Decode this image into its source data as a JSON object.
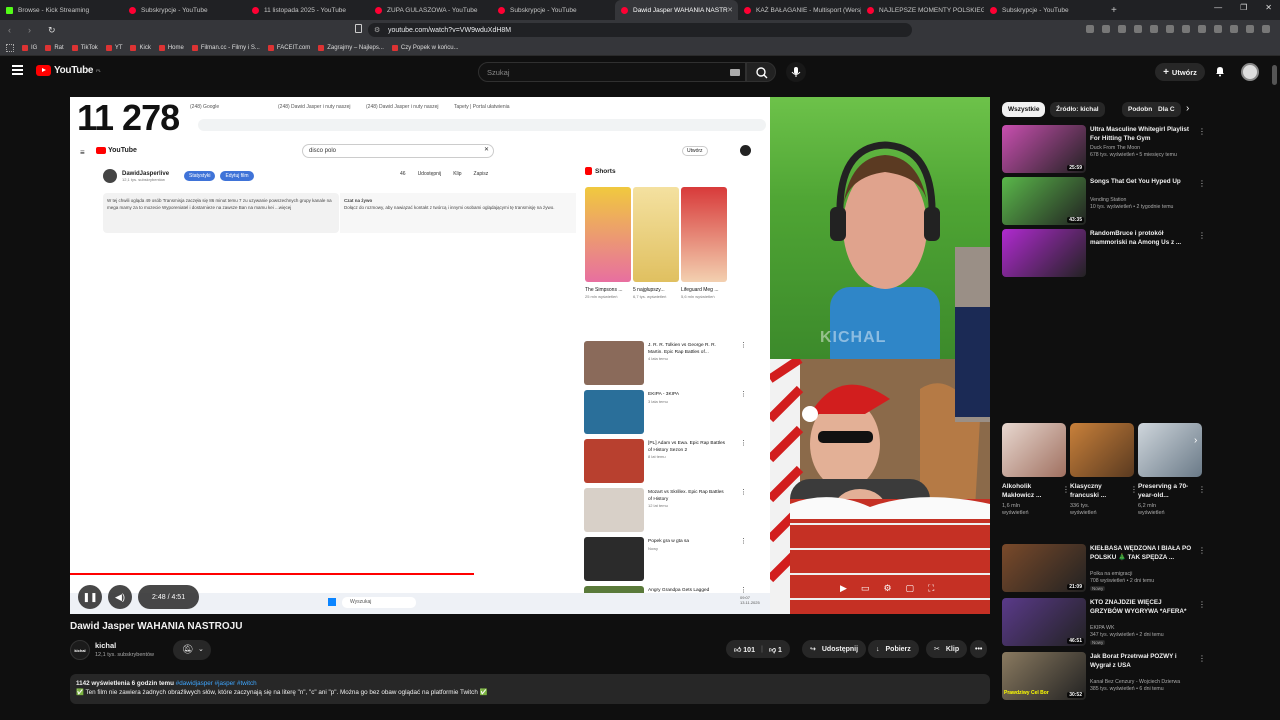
{
  "browser": {
    "tabs": [
      {
        "title": "Browse - Kick Streaming",
        "kind": "kick"
      },
      {
        "title": "Subskrypcje - YouTube",
        "kind": "yt"
      },
      {
        "title": "11 listopada 2025 - YouTube",
        "kind": "yt"
      },
      {
        "title": "ZUPA GULASZOWA - YouTube",
        "kind": "yt"
      },
      {
        "title": "Subskrypcje - YouTube",
        "kind": "yt"
      },
      {
        "title": "Dawid Jasper WAHANIA NASTR",
        "kind": "yt",
        "active": true
      },
      {
        "title": "KAŻ BAŁAGANIE - Multisport (Wersja",
        "kind": "yt"
      },
      {
        "title": "NAJLEPSZE MOMENTY POLSKIEGO",
        "kind": "yt"
      },
      {
        "title": "Subskrypcje - YouTube",
        "kind": "yt"
      }
    ],
    "url": "youtube.com/watch?v=VW9wduXdH8M",
    "bookmarks": [
      "IG",
      "Rat",
      "TikTok",
      "YT",
      "Kick",
      "Home",
      "Filman.cc - Filmy i S...",
      "FACEIT.com",
      "Zagrajmy – Najleps...",
      "Czy Popek w końcu..."
    ]
  },
  "youtube": {
    "logo_text": "YouTube",
    "logo_region": "PL",
    "search_placeholder": "Szukaj",
    "create_label": "Utwórz"
  },
  "player": {
    "counter": "11 278",
    "time": "2:48 / 4:51",
    "progress_fraction": 0.577,
    "watermark": "KICHAL",
    "inner": {
      "tabs": [
        "(248) Google",
        "(248) Dawid Jasper i nuty naszej",
        "(248) Dawid Jasper i nuty naszej",
        "Tapety | Portal ułatwienia"
      ],
      "logo": "YouTube",
      "search": "disco polo",
      "create": "Utwórz",
      "channel_name": "DawidJasperlive",
      "channel_subs": "12,1 tys. subskrybentów",
      "btn_stats": "Statystyki",
      "btn_edit": "Edytuj film",
      "actions": [
        "46",
        "Udostępnij",
        "Klip",
        "Zapisz"
      ],
      "desc": "W tej chwili ogląda 49 osób  Transmisja zaczęła się 86 minut temu\n7 zu uzywanie powszechnych grupy kanale na mega mamy za to mozecie Wyporeniatel i dostarnieze na zawsze Ban na mamu kei ...więcej",
      "chat_title": "Czat na żywo",
      "chat_text": "Dołącz do rozmowy, aby nawiązać kontakt z twórcą i innymi osobami oglądającymi tę transmisję na żywo.",
      "shorts_header": "Shorts",
      "shorts": [
        {
          "title": "The Simpsons ...",
          "views": "25 mln wyświetleń"
        },
        {
          "title": "5 najgłupszy...",
          "views": "6,7 tys. wyświetleń"
        },
        {
          "title": "Lifeguard Meg ...",
          "views": "5,6 mln wyświetleń"
        }
      ],
      "videos": [
        {
          "title": "J. R. R. Tolkien vs George R. R. Martin. Epic Rap Battles of...",
          "meta": "4 lata temu"
        },
        {
          "title": "EKIPA - 3KIPA",
          "meta": "3 lata temu"
        },
        {
          "title": "[PL] Adam vs Ewa. Epic Rap Battles of History Sezon 2",
          "meta": "8 lat temu"
        },
        {
          "title": "Mozart vs Skrillex. Epic Rap Battles of History",
          "meta": "12 lat temu"
        },
        {
          "title": "Popek gra w gta sa",
          "meta": "Nowy"
        },
        {
          "title": "Angry Grandpa Gets Lagged",
          "meta": ""
        }
      ],
      "taskbar_search": "Wyszukaj",
      "taskbar_clock": "09:07\n13.11.2025"
    }
  },
  "video": {
    "title": "Dawid Jasper WAHANIA NASTROJU",
    "channel": "kichal",
    "channel_avatar_text": "kichal",
    "subs": "12,1 tys. subskrybentów",
    "likes": "101",
    "dislikes": "1",
    "share": "Udostępnij",
    "download": "Pobierz",
    "clip": "Klip",
    "views_time": "1142 wyświetlenia  6 godzin temu",
    "hashtags": "#dawidjasper #jasper #twitch",
    "description_line": "✅ Ten film nie zawiera żadnych obraźliwych słów, które zaczynają się na literę \"n\", \"c\" ani \"p\". Można go bez obaw oglądać na platformie Twitch ✅"
  },
  "sidebar": {
    "chips": [
      "Wszystkie",
      "Źródło: kichal",
      "Podobne",
      "Dla C"
    ],
    "top_videos": [
      {
        "title": "Ultra Masculine Whitegirl Playlist For Hitting The Gym",
        "channel": "Duck From The Moon",
        "meta": "678 tys. wyświetleń • 5 miesięcy temu",
        "duration": "25:59",
        "color": "#c94fb0"
      },
      {
        "title": "Songs That Get You Hyped Up",
        "channel": "Vending Station",
        "meta": "10 tys. wyświetleń • 2 tygodnie temu",
        "duration": "43:35",
        "color": "#5ab84a"
      },
      {
        "title": "RandomBruce i protokół mammoriski na Among Us z ...",
        "channel": "",
        "meta": "",
        "duration": "",
        "color": "#b02ad0"
      }
    ],
    "shorts": [
      {
        "title": "Alkoholik Makłowicz ...",
        "views": "1,6 mln wyświetleń"
      },
      {
        "title": "Klasyczny francuski ...",
        "views": "336 tys. wyświetleń"
      },
      {
        "title": "Preserving a 70-year-old...",
        "views": "6,2 mln wyświetleń"
      }
    ],
    "bottom_videos": [
      {
        "title": "KIEŁBASA WĘDZONA I BIAŁA PO POLSKU 🎄 TAK SPĘDZA ...",
        "channel": "Polka na emigracji",
        "meta": "708 wyświetleń • 2 dni temu",
        "badge": "Nowy",
        "duration": "21:09",
        "color": "#7a4a2a"
      },
      {
        "title": "KTO ZNAJDZIE WIĘCEJ GRZYBÓW WYGRYWA *AFERA*",
        "channel": "EKIPA WK",
        "meta": "347 tys. wyświetleń • 2 dni temu",
        "badge": "Nowy",
        "duration": "46:51",
        "color": "#5a3a8a"
      },
      {
        "title": "Jak Borat Przetrwał POZWY i Wygrał z USA",
        "channel": "Kanał Bez Cenzury - Wojciech Dzierwa",
        "meta": "385 tys. wyświetleń • 6 dni temu",
        "badge": "",
        "duration": "30:52",
        "color": "#8a7a60",
        "caption": "Prawdziwy Cel Bor"
      }
    ]
  }
}
